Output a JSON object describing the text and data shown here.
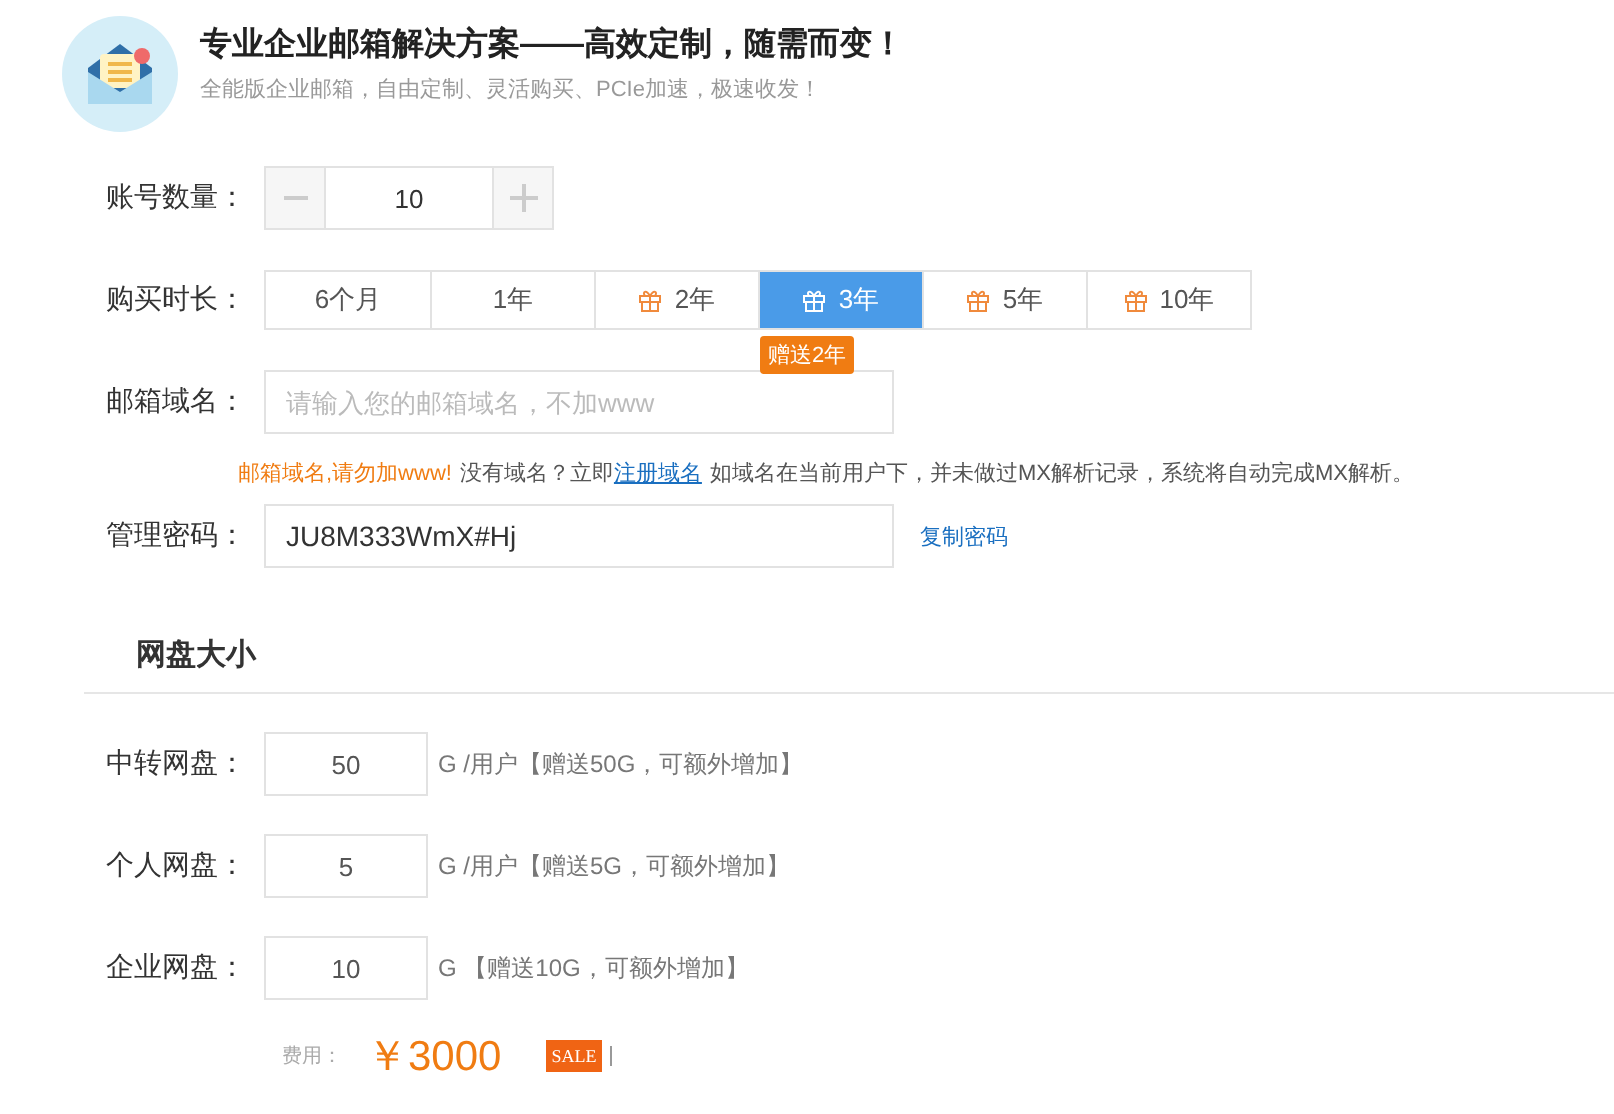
{
  "header": {
    "title": "专业企业邮箱解决方案——高效定制，随需而变！",
    "subtitle": "全能版企业邮箱，自由定制、灵活购买、PCIe加速，极速收发！"
  },
  "account_count": {
    "label": "账号数量：",
    "value": "10"
  },
  "duration": {
    "label": "购买时长：",
    "badge": "赠送2年",
    "tabs": [
      {
        "label": "6个月",
        "gift": false,
        "selected": false
      },
      {
        "label": "1年",
        "gift": false,
        "selected": false
      },
      {
        "label": "2年",
        "gift": true,
        "selected": false
      },
      {
        "label": "3年",
        "gift": true,
        "selected": true
      },
      {
        "label": "5年",
        "gift": true,
        "selected": false
      },
      {
        "label": "10年",
        "gift": true,
        "selected": false
      }
    ]
  },
  "domain": {
    "label": "邮箱域名：",
    "placeholder": "请输入您的邮箱域名，不加www",
    "warning": "邮箱域名,请勿加www!",
    "hint_before": "没有域名？立即",
    "link": "注册域名",
    "hint_after": "如域名在当前用户下，并未做过MX解析记录，系统将自动完成MX解析。"
  },
  "password": {
    "label": "管理密码：",
    "value": "JU8M333WmX#Hj",
    "copy_link": "复制密码"
  },
  "disk_section": {
    "title": "网盘大小",
    "rows": [
      {
        "label": "中转网盘：",
        "value": "50",
        "note": "G /用户【赠送50G，可额外增加】"
      },
      {
        "label": "个人网盘：",
        "value": "5",
        "note": "G /用户【赠送5G，可额外增加】"
      },
      {
        "label": "企业网盘：",
        "value": "10",
        "note": "G 【赠送10G，可额外增加】"
      }
    ]
  },
  "fee": {
    "label": "费用：",
    "price": "￥3000",
    "tag": "SALE"
  }
}
